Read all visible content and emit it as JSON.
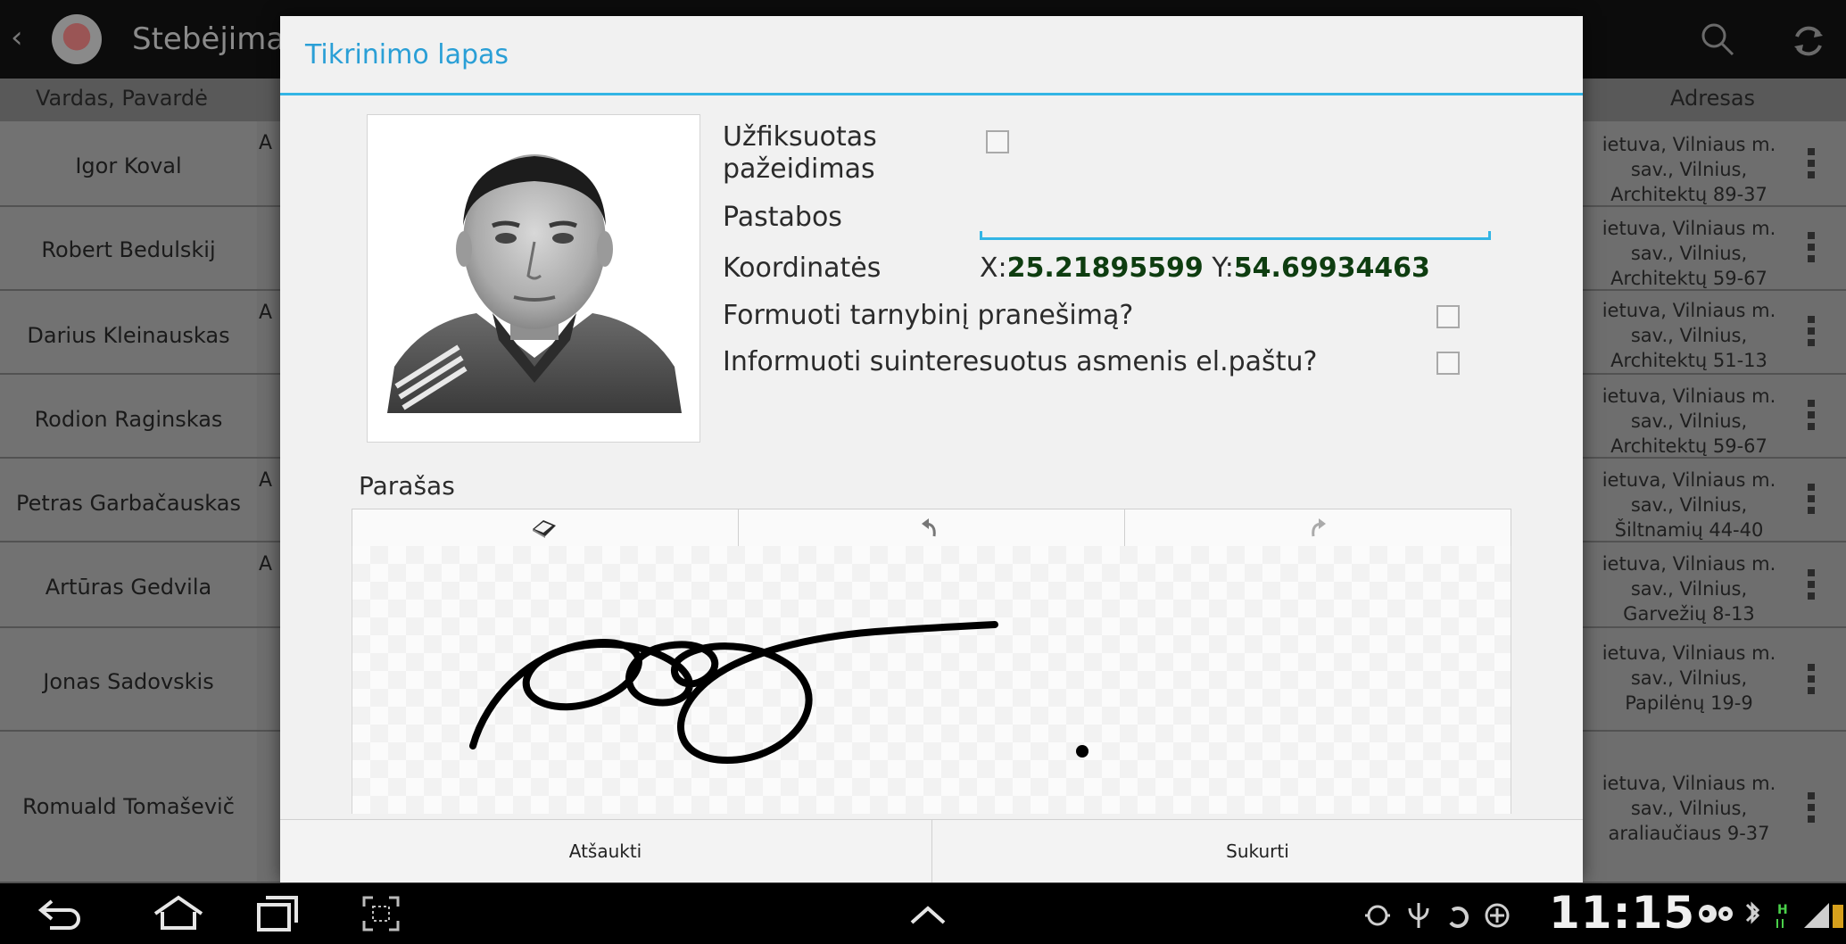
{
  "action_bar": {
    "title": "Stebėjimas",
    "back_icon": "chevron-left-icon",
    "search_icon": "search-icon",
    "refresh_icon": "refresh-icon"
  },
  "columns": {
    "name": "Vardas, Pavardė",
    "address": "Adresas"
  },
  "rows": [
    {
      "name": "Igor Koval",
      "mid": "A",
      "addr": [
        "ietuva, Vilniaus m.",
        "sav., Vilnius,",
        "Architektų 89-37"
      ]
    },
    {
      "name": "Robert Bedulskij",
      "mid": "",
      "addr": [
        "ietuva, Vilniaus m.",
        "sav., Vilnius,",
        "Architektų 59-67"
      ]
    },
    {
      "name": "Darius Kleinauskas",
      "mid": "A",
      "addr": [
        "ietuva, Vilniaus m.",
        "sav., Vilnius,",
        "Architektų 51-13"
      ]
    },
    {
      "name": "Rodion Raginskas",
      "mid": "",
      "addr": [
        "ietuva, Vilniaus m.",
        "sav., Vilnius,",
        "Architektų 59-67"
      ]
    },
    {
      "name": "Petras Garbačauskas",
      "mid": "A",
      "addr": [
        "ietuva, Vilniaus m.",
        "sav., Vilnius,",
        "Šiltnamių 44-40"
      ]
    },
    {
      "name": "Artūras Gedvila",
      "mid": "A",
      "addr": [
        "ietuva, Vilniaus m.",
        "sav., Vilnius,",
        "Garvežių 8-13"
      ]
    },
    {
      "name": "Jonas Sadovskis",
      "mid": "",
      "addr": [
        "ietuva, Vilniaus m.",
        "sav., Vilnius,",
        "Papilėnų 19-9"
      ]
    },
    {
      "name": "Romuald Tomaševič",
      "mid": "",
      "addr": [
        "ietuva, Vilniaus m.",
        "sav., Vilnius,",
        "araliaučiaus 9-37"
      ]
    }
  ],
  "dialog": {
    "title": "Tikrinimo lapas",
    "violation_label_1": "Užfiksuotas",
    "violation_label_2": "pažeidimas",
    "violation_checked": false,
    "notes_label": "Pastabos",
    "notes_value": "",
    "coords_label": "Koordinatės",
    "x_prefix": "X:",
    "x_value": "25.21895599",
    "y_prefix": " Y:",
    "y_value": "54.69934463",
    "report_label": "Formuoti tarnybinį pranešimą?",
    "report_checked": false,
    "email_label": "Informuoti suinteresuotus asmenis el.paštu?",
    "email_checked": false,
    "signature_label": "Parašas",
    "toolbar_icons": [
      "eraser-icon",
      "undo-icon",
      "redo-icon"
    ],
    "cancel_label": "Atšaukti",
    "create_label": "Sukurti"
  },
  "status_bar": {
    "time": "11:15"
  }
}
